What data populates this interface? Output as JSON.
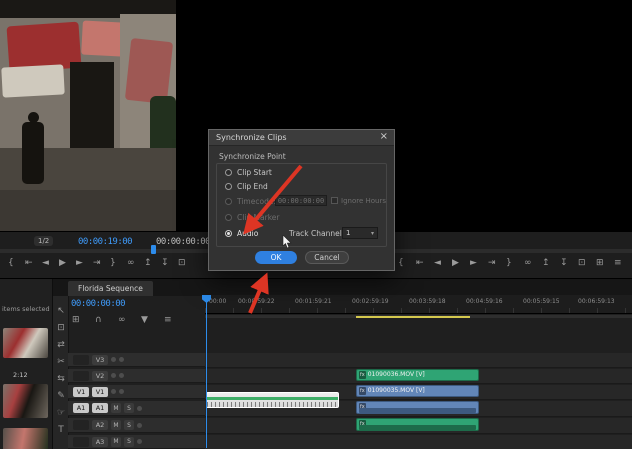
{
  "monitor": {
    "zoom_badge": "1/2",
    "position_timecode": "00:00:19:00",
    "duration_timecode": "00:00:00:00"
  },
  "dialog": {
    "title": "Synchronize Clips",
    "close_glyph": "×",
    "group_label": "Synchronize Point",
    "options": {
      "clip_start": "Clip Start",
      "clip_end": "Clip End",
      "timecode": "Timecode:",
      "clip_marker": "Clip Marker",
      "audio": "Audio"
    },
    "timecode_value": "00:00:00:00",
    "ignore_hours_label": "Ignore Hours",
    "track_channel_label": "Track Channel",
    "track_channel_value": "1",
    "dropdown_glyph": "▾",
    "ok_label": "OK",
    "cancel_label": "Cancel"
  },
  "project_panel": {
    "selection_status": "items selected",
    "thumb_duration": "2:12"
  },
  "timeline": {
    "tab_title": "Florida Sequence",
    "playhead_timecode": "00:00:00:00",
    "ruler_labels": [
      "00:00",
      "00:00:59:22",
      "00:01:59:21",
      "00:02:59:19",
      "00:03:59:18",
      "00:04:59:16",
      "00:05:59:15",
      "00:06:59:13"
    ],
    "tracks": {
      "v3": "V3",
      "v2": "V2",
      "v1": "V1",
      "a1": "A1",
      "a2": "A2",
      "a3": "A3"
    },
    "audio_buttons": {
      "mute": "M",
      "solo": "S"
    },
    "clips": {
      "green_video_label": "01090036.MOV [V]",
      "blue_video_label": "01090035.MOV [V]",
      "fx_badge": "fx"
    }
  },
  "colors": {
    "accent_blue": "#2d8ceb",
    "clip_green": "#2fa474",
    "clip_blue": "#6286b8",
    "render_bar_yellow": "#d4c84e",
    "annotation_red": "#dd3524"
  },
  "icons": {
    "selection_tool": "↖",
    "track_select_tool": "⊡",
    "ripple_edit_tool": "⇄",
    "razor_tool": "✂",
    "slip_tool": "⇆",
    "pen_tool": "✎",
    "hand_tool": "☞",
    "type_tool": "T",
    "nest_toggle": "⊞",
    "snap_toggle": "∩",
    "linked_selection_toggle": "∞",
    "add_marker": "▼",
    "settings_menu": "≡",
    "mark_in": "{",
    "mark_out": "}",
    "go_to_in": "⇤",
    "go_to_out": "⇥",
    "step_back": "◄",
    "play": "▶",
    "step_forward": "►",
    "loop": "∞",
    "lift": "↥",
    "extract": "↧",
    "export_frame": "⊡",
    "compare": "⊞"
  }
}
